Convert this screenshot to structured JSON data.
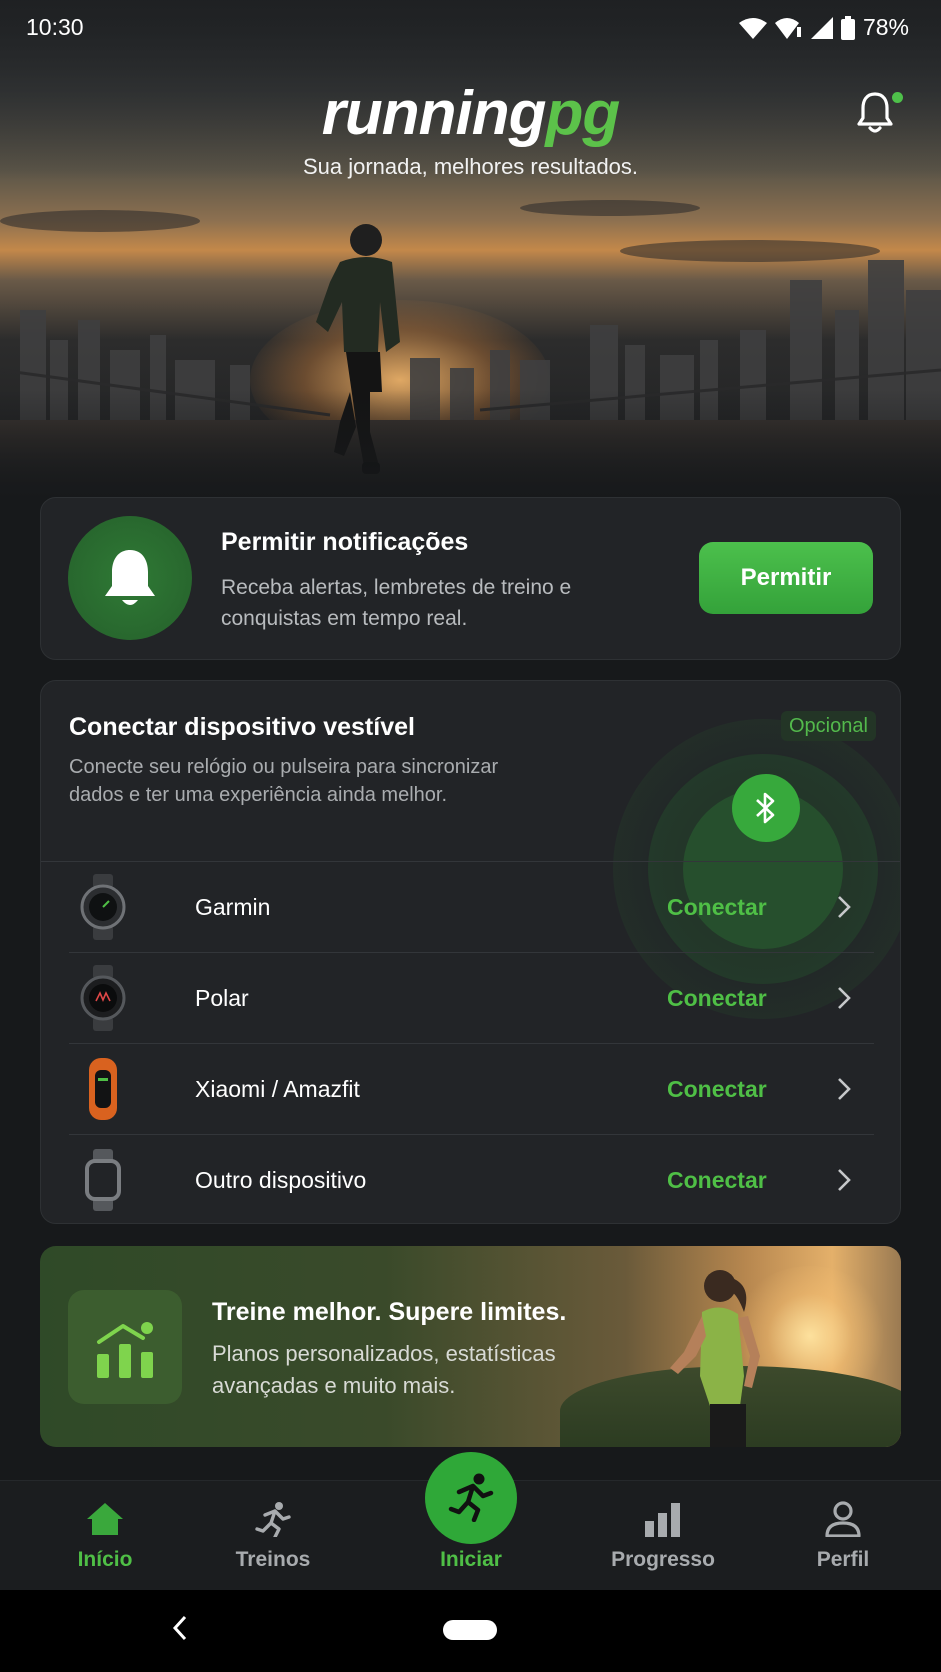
{
  "status_bar": {
    "time": "10:30",
    "battery": "78%"
  },
  "header": {
    "logo_part1": "running",
    "logo_part2": "pg",
    "tagline": "Sua jornada, melhores resultados."
  },
  "notification_card": {
    "title": "Permitir notificações",
    "description": "Receba alertas, lembretes de treino e conquistas em tempo real.",
    "button": "Permitir"
  },
  "wearable_card": {
    "title": "Conectar dispositivo vestível",
    "description": "Conecte seu relógio ou pulseira para sincronizar dados e ter uma experiência ainda melhor.",
    "badge": "Opcional",
    "devices": [
      {
        "name": "Garmin",
        "action": "Conectar",
        "icon": "smartwatch-icon"
      },
      {
        "name": "Polar",
        "action": "Conectar",
        "icon": "smartwatch-icon"
      },
      {
        "name": "Xiaomi / Amazfit",
        "action": "Conectar",
        "icon": "fitness-band-icon"
      },
      {
        "name": "Outro dispositivo",
        "action": "Conectar",
        "icon": "generic-watch-icon"
      }
    ]
  },
  "promo": {
    "title": "Treine melhor. Supere limites.",
    "description": "Planos personalizados, estatísticas avançadas e muito mais."
  },
  "bottom_nav": {
    "items": [
      {
        "label": "Início",
        "icon": "home-icon",
        "active": true
      },
      {
        "label": "Treinos",
        "icon": "runner-icon",
        "active": false
      },
      {
        "label": "Iniciar",
        "icon": "runner-icon",
        "active": false
      },
      {
        "label": "Progresso",
        "icon": "bar-chart-icon",
        "active": false
      },
      {
        "label": "Perfil",
        "icon": "user-icon",
        "active": false
      }
    ]
  },
  "colors": {
    "accent": "#4fbf46",
    "background": "#17191b",
    "card": "#222427"
  }
}
